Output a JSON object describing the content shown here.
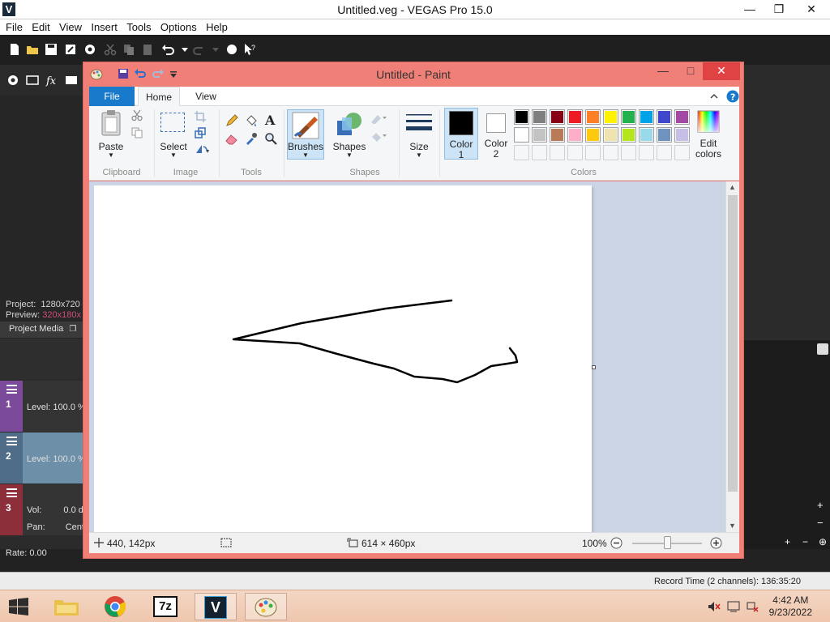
{
  "vegas": {
    "window_title": "Untitled.veg - VEGAS Pro 15.0",
    "app_icon_letter": "V",
    "menu": [
      "File",
      "Edit",
      "View",
      "Insert",
      "Tools",
      "Options",
      "Help"
    ],
    "project_label": "Project:",
    "project_value": "1280x720",
    "preview_label": "Preview:",
    "preview_value": "320x180x",
    "project_media_tab": "Project Media",
    "tracks": [
      {
        "number": "1",
        "label": "Level: 100.0 %",
        "color": "#7b4a9a"
      },
      {
        "number": "2",
        "label": "Level: 100.0 %",
        "color": "#6d8fa8"
      },
      {
        "number": "3",
        "vol_label": "Vol:",
        "vol_value": "0.0 d",
        "pan_label": "Pan:",
        "pan_value": "Cent",
        "color": "#8c2f3a"
      }
    ],
    "rate": "Rate: 0.00",
    "record_time": "Record Time (2 channels): 136:35:20"
  },
  "paint": {
    "title": "Untitled - Paint",
    "tabs": {
      "file": "File",
      "home": "Home",
      "view": "View"
    },
    "clipboard": {
      "paste": "Paste",
      "group": "Clipboard"
    },
    "image": {
      "select": "Select",
      "group": "Image"
    },
    "tools": {
      "group": "Tools"
    },
    "brushes": {
      "label": "Brushes"
    },
    "shapes": {
      "label": "Shapes",
      "group": "Shapes"
    },
    "size": {
      "label": "Size"
    },
    "colors": {
      "color1_label_line1": "Color",
      "color1_label_line2": "1",
      "color2_label_line1": "Color",
      "color2_label_line2": "2",
      "edit_line1": "Edit",
      "edit_line2": "colors",
      "group": "Colors",
      "color1": "#000000",
      "color2": "#ffffff",
      "palette_row1": [
        "#000000",
        "#7f7f7f",
        "#880015",
        "#ed1c24",
        "#ff7f27",
        "#fff200",
        "#22b14c",
        "#00a2e8",
        "#3f48cc",
        "#a349a4"
      ],
      "palette_row2": [
        "#ffffff",
        "#c3c3c3",
        "#b97a57",
        "#ffaec9",
        "#ffc90e",
        "#efe4b0",
        "#b5e61d",
        "#99d9ea",
        "#7092be",
        "#c8bfe7"
      ]
    },
    "status": {
      "cursor_pos": "440, 142px",
      "canvas_size": "614 × 460px",
      "zoom": "100%",
      "zoom_fraction": 0.5
    }
  },
  "taskbar": {
    "clock_time": "4:42 AM",
    "clock_date": "9/23/2022",
    "sevenzip_label": "7z",
    "vegas_label": "V"
  }
}
